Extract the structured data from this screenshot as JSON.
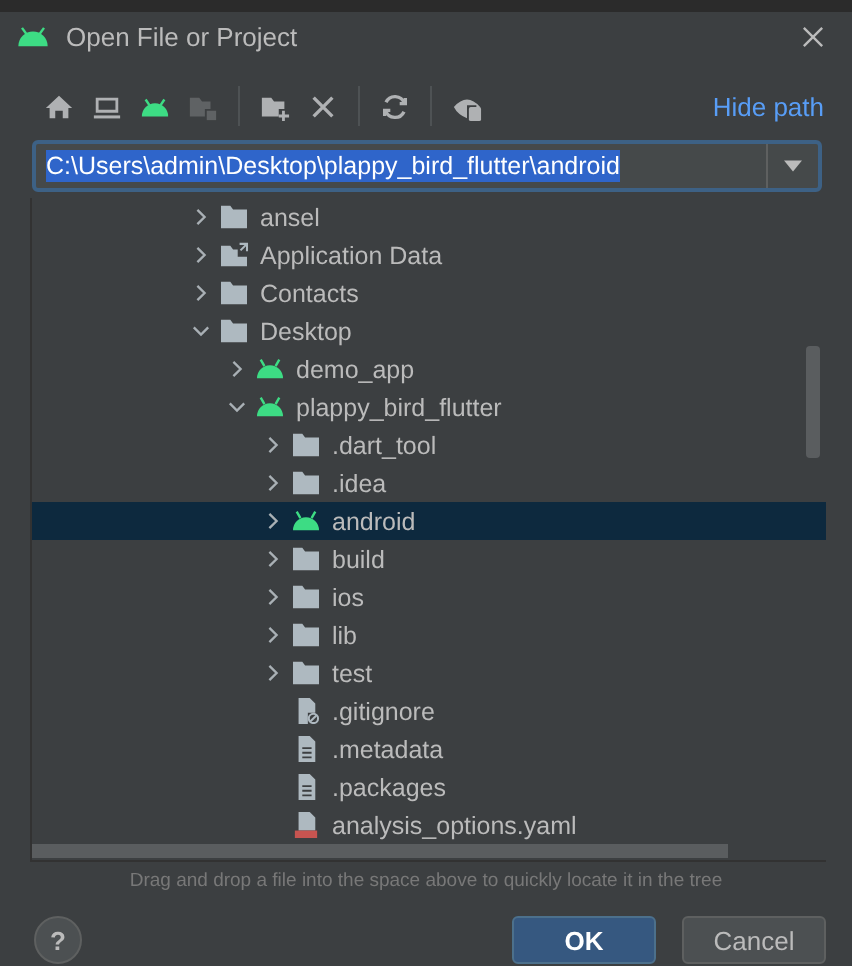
{
  "window": {
    "title": "Open File or Project"
  },
  "toolbar_groups": [
    [
      {
        "kind": "home",
        "disabled": false
      },
      {
        "kind": "desktop",
        "disabled": false
      },
      {
        "kind": "android",
        "disabled": false
      },
      {
        "kind": "module",
        "disabled": true
      }
    ],
    [
      {
        "kind": "new-folder",
        "disabled": false
      },
      {
        "kind": "delete",
        "disabled": false
      }
    ],
    [
      {
        "kind": "refresh",
        "disabled": false
      }
    ],
    [
      {
        "kind": "show-hidden",
        "disabled": false
      }
    ]
  ],
  "hide_path_link": "Hide path",
  "path_field": {
    "value": "C:\\Users\\admin\\Desktop\\plappy_bird_flutter\\android",
    "text_selected": true
  },
  "tree": [
    {
      "name": "ansel",
      "kind": "folder",
      "expanded": false,
      "selected": false
    },
    {
      "name": "Application Data",
      "kind": "folder-link",
      "expanded": false,
      "selected": false
    },
    {
      "name": "Contacts",
      "kind": "folder",
      "expanded": false,
      "selected": false
    },
    {
      "name": "Desktop",
      "kind": "folder",
      "expanded": true,
      "selected": false,
      "children": [
        {
          "name": "demo_app",
          "kind": "android",
          "expanded": false,
          "selected": false
        },
        {
          "name": "plappy_bird_flutter",
          "kind": "android",
          "expanded": true,
          "selected": false,
          "children": [
            {
              "name": ".dart_tool",
              "kind": "folder",
              "expanded": false,
              "selected": false
            },
            {
              "name": ".idea",
              "kind": "folder",
              "expanded": false,
              "selected": false
            },
            {
              "name": "android",
              "kind": "android",
              "expanded": false,
              "selected": true
            },
            {
              "name": "build",
              "kind": "folder",
              "expanded": false,
              "selected": false
            },
            {
              "name": "ios",
              "kind": "folder",
              "expanded": false,
              "selected": false
            },
            {
              "name": "lib",
              "kind": "folder",
              "expanded": false,
              "selected": false
            },
            {
              "name": "test",
              "kind": "folder",
              "expanded": false,
              "selected": false
            },
            {
              "name": ".gitignore",
              "kind": "ignore-file",
              "selected": false
            },
            {
              "name": ".metadata",
              "kind": "file",
              "selected": false
            },
            {
              "name": ".packages",
              "kind": "file",
              "selected": false
            },
            {
              "name": "analysis_options.yaml",
              "kind": "yaml-file",
              "selected": false
            }
          ]
        }
      ]
    }
  ],
  "hint": "Drag and drop a file into the space above to quickly locate it in the tree",
  "help_button": "?",
  "buttons": [
    {
      "label": "OK",
      "kind": "primary"
    },
    {
      "label": "Cancel",
      "kind": "secondary"
    }
  ]
}
